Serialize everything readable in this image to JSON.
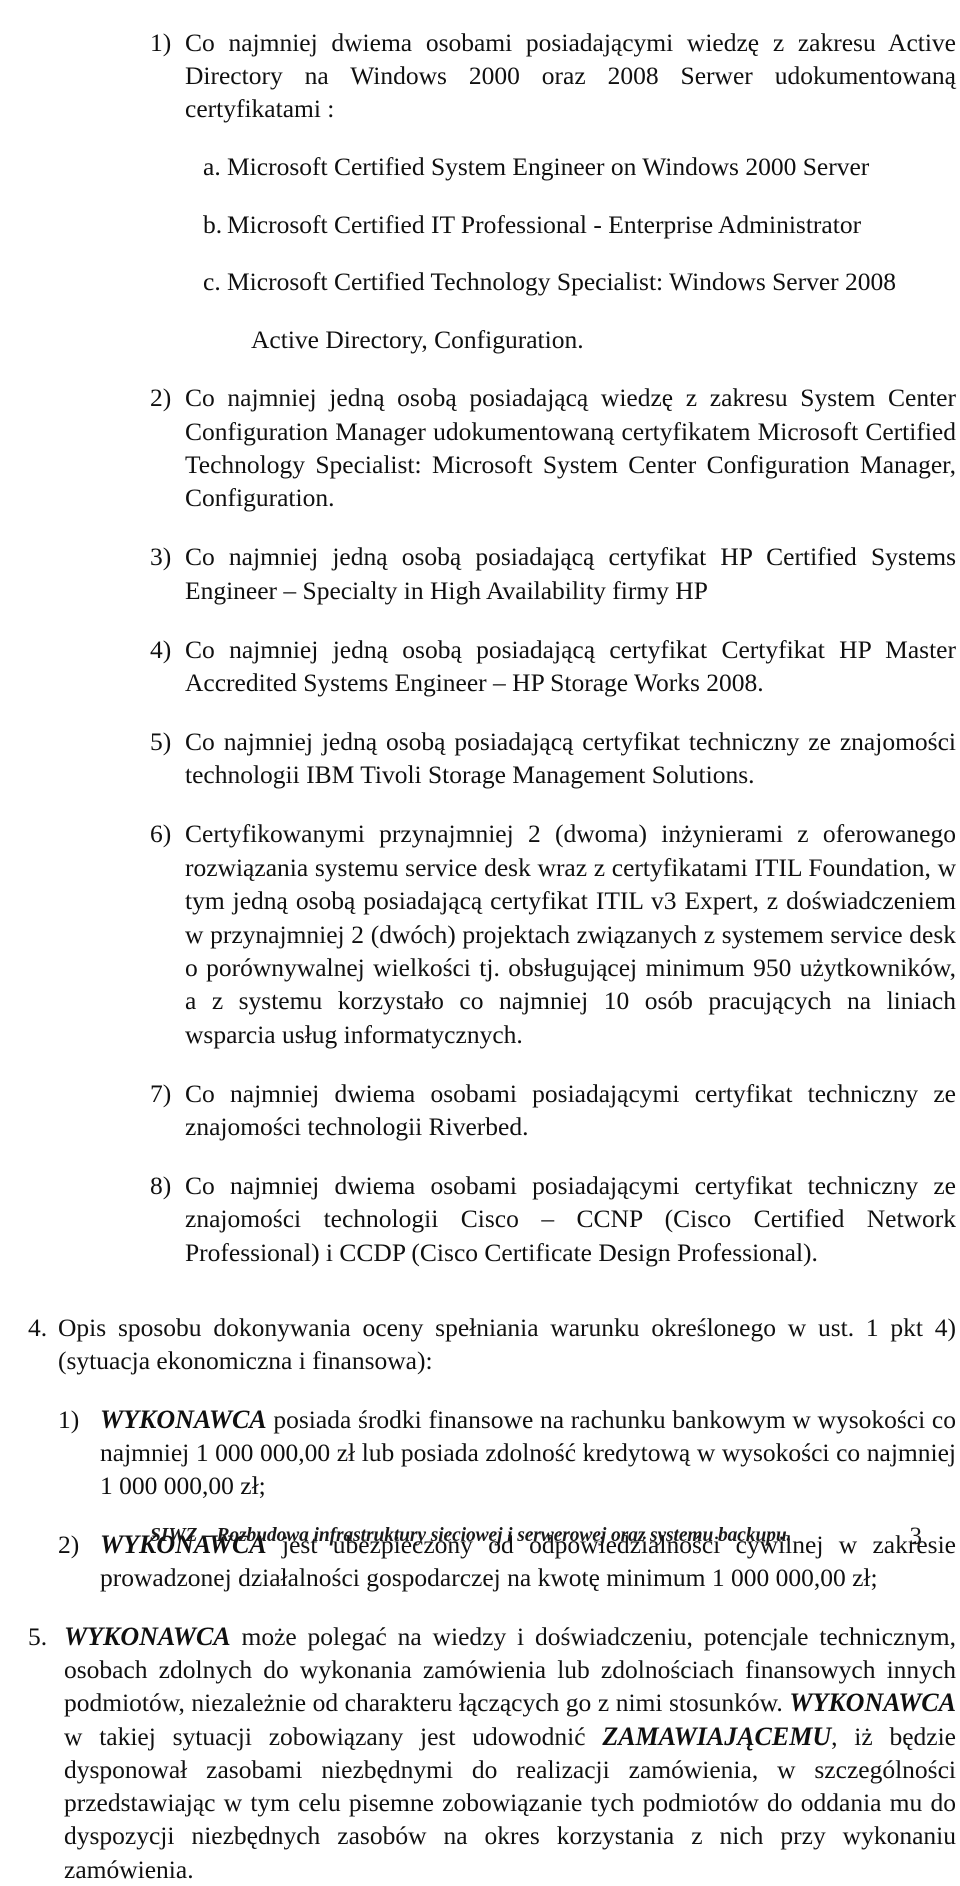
{
  "document": {
    "type": "scanned-tender-document",
    "language": "pl",
    "page_number": "3"
  },
  "certificates_list": {
    "items": [
      {
        "marker": "1)",
        "text": "Co najmniej dwiema osobami posiadającymi wiedzę z zakresu Active Directory na Windows 2000 oraz 2008 Serwer udokumentowaną certyfikatami :"
      },
      {
        "marker": "2)",
        "text": "Co najmniej jedną osobą posiadającą wiedzę z zakresu System Center Configuration Manager udokumentowaną certyfikatem Microsoft Certified Technology Specialist: Microsoft System Center Configuration Manager, Configuration."
      },
      {
        "marker": "3)",
        "text": "Co najmniej jedną osobą posiadającą certyfikat HP Certified Systems Engineer – Specialty in High Availability firmy HP"
      },
      {
        "marker": "4)",
        "text": "Co najmniej jedną osobą posiadającą certyfikat Certyfikat HP Master Accredited Systems Engineer – HP Storage Works 2008."
      },
      {
        "marker": "5)",
        "text": "Co najmniej jedną osobą posiadającą certyfikat techniczny ze znajomości technologii IBM Tivoli Storage Management Solutions."
      },
      {
        "marker": "6)",
        "text": "Certyfikowanymi przynajmniej 2 (dwoma) inżynierami z oferowanego rozwiązania systemu service desk wraz z certyfikatami ITIL Foundation, w tym jedną osobą posiadającą certyfikat ITIL v3 Expert, z doświadczeniem w przynajmniej 2 (dwóch) projektach związanych z systemem service desk o porównywalnej wielkości tj. obsługującej minimum 950 użytkowników, a z systemu korzystało co najmniej 10 osób pracujących na liniach wsparcia usług informatycznych."
      },
      {
        "marker": "7)",
        "text": "Co najmniej dwiema osobami posiadającymi certyfikat techniczny ze znajomości technologii Riverbed."
      },
      {
        "marker": "8)",
        "text": "Co najmniej dwiema osobami posiadającymi certyfikat techniczny ze znajomości technologii Cisco – CCNP (Cisco Certified Network Professional) i CCDP (Cisco Certificate Design Professional)."
      }
    ],
    "sub_items": [
      {
        "marker": "a.",
        "text": "Microsoft Certified System Engineer on Windows 2000 Server"
      },
      {
        "marker": "b.",
        "text": "Microsoft Certified IT Professional - Enterprise Administrator"
      },
      {
        "marker": "c.",
        "text": "Microsoft Certified Technology Specialist: Windows Server 2008"
      },
      {
        "marker": "",
        "text": "Active Directory, Configuration."
      }
    ]
  },
  "economic_section": {
    "heading": {
      "marker": "4.",
      "text": "Opis sposobu dokonywania oceny spełniania warunku określonego w ust. 1 pkt 4) (sytuacja ekonomiczna i finansowa):"
    },
    "items": [
      {
        "marker": "1)",
        "emphasis": "WYKONAWCA",
        "text": " posiada środki finansowe na rachunku bankowym w wysokości co najmniej  1 000 000,00 zł lub posiada zdolność kredytową w wysokości co najmniej 1 000 000,00 zł;"
      },
      {
        "marker": "2)",
        "emphasis": "WYKONAWCA",
        "text": " jest ubezpieczony od odpowiedzialności cywilnej w zakresie prowadzonej działalności gospodarczej na kwotę minimum 1 000 000,00 zł;"
      }
    ]
  },
  "reliance_section": {
    "marker": "5.",
    "emphasis_1": "WYKONAWCA",
    "part_1": " może polegać na wiedzy i doświadczeniu, potencjale technicznym, osobach zdolnych do wykonania zamówienia lub zdolnościach finansowych innych podmiotów, niezależnie od charakteru łączących go z nimi stosunków. ",
    "emphasis_2": "WYKONAWCA",
    "part_2": " w takiej sytuacji zobowiązany jest udowodnić ",
    "emphasis_3": "ZAMAWIAJĄCEMU",
    "part_3": ", iż będzie dysponował zasobami niezbędnymi do realizacji zamówienia, w szczególności przedstawiając w tym celu pisemne zobowiązanie tych podmiotów do oddania mu do dyspozycji niezbędnych zasobów na okres korzystania z nich przy wykonaniu zamówienia."
  },
  "footer": {
    "text": "SIWZ – Rozbudowa infrastruktury sieciowej i serwerowej  oraz systemu backupu.",
    "page": "3"
  }
}
